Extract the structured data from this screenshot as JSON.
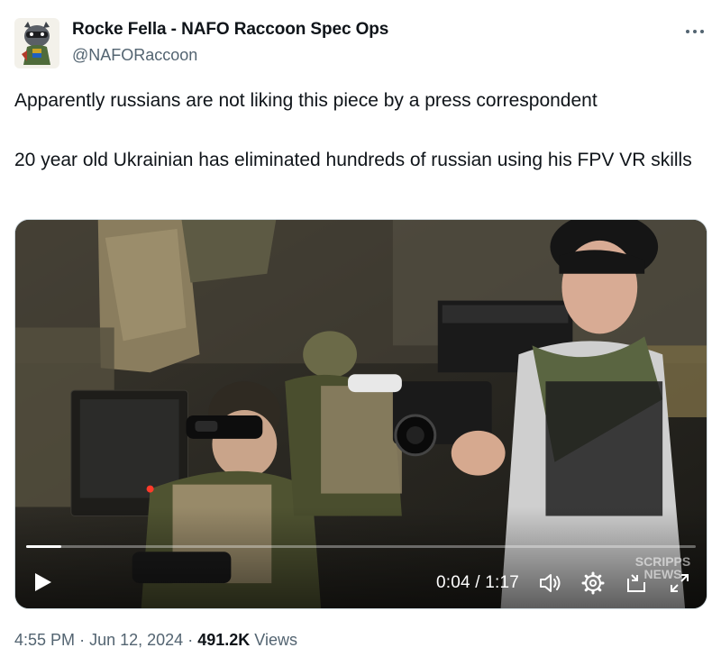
{
  "author": {
    "name": "Rocke Fella - NAFO Raccoon Spec Ops",
    "handle": "@NAFORaccoon"
  },
  "tweet": {
    "line1": "Apparently russians are not liking this piece by a press correspondent",
    "line2": "20 year old Ukrainian has eliminated hundreds of russian using his FPV VR skills"
  },
  "video": {
    "current_time": "0:04",
    "separator": "/",
    "duration": "1:17",
    "progress_fraction": 0.052,
    "watermark": "SCRIPPS NEWS"
  },
  "meta": {
    "time": "4:55 PM",
    "date": "Jun 12, 2024",
    "views_count": "491.2K",
    "views_label": "Views",
    "dot": "·"
  },
  "icons": {
    "more": "more-horizontal-icon",
    "play": "play-icon",
    "volume": "volume-icon",
    "settings": "gear-icon",
    "pip": "picture-in-picture-icon",
    "fullscreen": "fullscreen-icon"
  },
  "colors": {
    "text_primary": "#0f1419",
    "text_secondary": "#536471",
    "border": "#cfd9de"
  }
}
